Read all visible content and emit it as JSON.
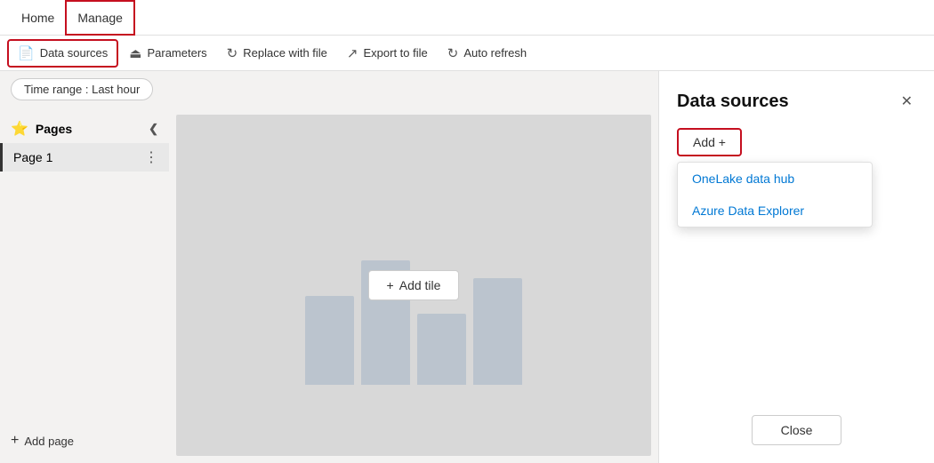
{
  "topnav": {
    "home_label": "Home",
    "manage_label": "Manage"
  },
  "toolbar": {
    "datasources_label": "Data sources",
    "parameters_label": "Parameters",
    "replace_label": "Replace with file",
    "export_label": "Export to file",
    "autorefresh_label": "Auto refresh"
  },
  "filterbar": {
    "timerange_label": "Time range : Last hour"
  },
  "pages_sidebar": {
    "title": "Pages",
    "page1_label": "Page 1",
    "add_page_label": "Add page"
  },
  "canvas": {
    "add_tile_label": "Add tile"
  },
  "right_panel": {
    "title": "Data sources",
    "add_label": "Add +",
    "menu_items": [
      {
        "label": "OneLake data hub"
      },
      {
        "label": "Azure Data Explorer"
      }
    ],
    "close_label": "Close"
  }
}
